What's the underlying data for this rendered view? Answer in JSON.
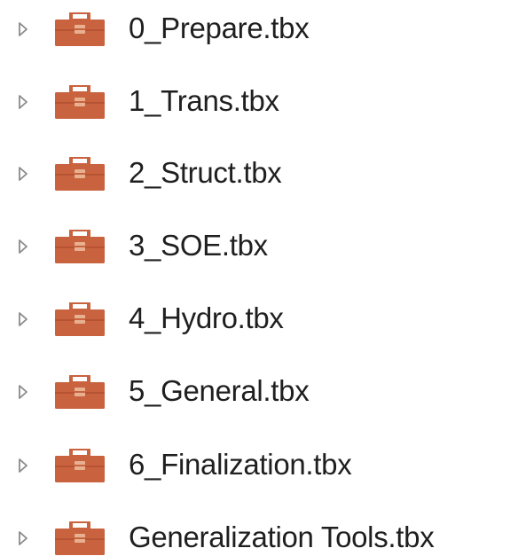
{
  "catalog": {
    "items": [
      {
        "label": "0_Prepare.tbx",
        "icon": "toolbox-icon"
      },
      {
        "label": "1_Trans.tbx",
        "icon": "toolbox-icon"
      },
      {
        "label": "2_Struct.tbx",
        "icon": "toolbox-icon"
      },
      {
        "label": "3_SOE.tbx",
        "icon": "toolbox-icon"
      },
      {
        "label": "4_Hydro.tbx",
        "icon": "toolbox-icon"
      },
      {
        "label": "5_General.tbx",
        "icon": "toolbox-icon"
      },
      {
        "label": "6_Finalization.tbx",
        "icon": "toolbox-icon"
      },
      {
        "label": "Generalization Tools.tbx",
        "icon": "toolbox-icon"
      }
    ],
    "expander_icon": "chevron-right-icon",
    "colors": {
      "toolbox_fill": "#c9633f",
      "toolbox_handle": "#e8b08f",
      "expander": "#8a8a8a",
      "text": "#1f1f1f"
    }
  }
}
